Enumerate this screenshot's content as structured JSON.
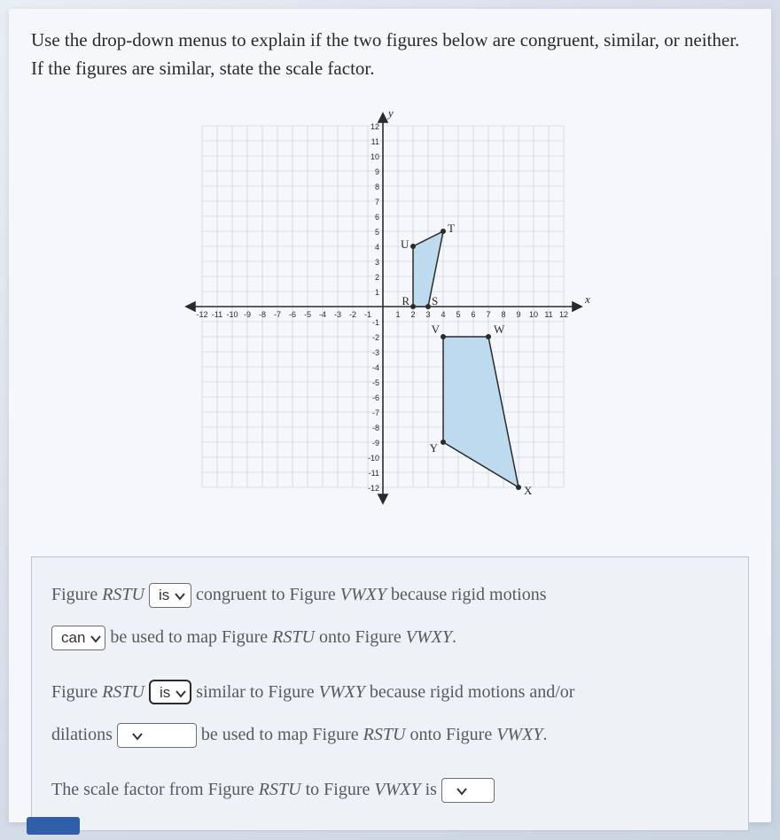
{
  "prompt": "Use the drop-down menus to explain if the two figures below are congruent, similar, or neither. If the figures are similar, state the scale factor.",
  "axis": {
    "xlabel": "x",
    "ylabel": "y",
    "x_ticks": [
      "-12",
      "-11",
      "-10",
      "-9",
      "-8",
      "-7",
      "-6",
      "-5",
      "-4",
      "-3",
      "-2",
      "-1",
      "1",
      "2",
      "3",
      "4",
      "5",
      "6",
      "7",
      "8",
      "9",
      "10",
      "11",
      "12"
    ],
    "y_ticks_pos": [
      "12",
      "11",
      "10",
      "9",
      "8",
      "7",
      "6",
      "5",
      "4",
      "3",
      "2",
      "1"
    ],
    "y_ticks_neg": [
      "-1",
      "-2",
      "-3",
      "-4",
      "-5",
      "-6",
      "-7",
      "-8",
      "-9",
      "-10",
      "-11",
      "-12"
    ]
  },
  "chart_data": {
    "type": "scatter",
    "title": "",
    "xlabel": "x",
    "ylabel": "y",
    "xlim": [
      -12,
      12
    ],
    "ylim": [
      -12,
      12
    ],
    "series": [
      {
        "name": "RSTU",
        "points": [
          {
            "label": "R",
            "x": 2,
            "y": 0
          },
          {
            "label": "S",
            "x": 3,
            "y": 0
          },
          {
            "label": "T",
            "x": 4,
            "y": 5
          },
          {
            "label": "U",
            "x": 2,
            "y": 4
          }
        ]
      },
      {
        "name": "VWXY",
        "points": [
          {
            "label": "V",
            "x": 4,
            "y": -2
          },
          {
            "label": "W",
            "x": 7,
            "y": -2
          },
          {
            "label": "X",
            "x": 9,
            "y": -12
          },
          {
            "label": "Y",
            "x": 4,
            "y": -9
          }
        ]
      }
    ]
  },
  "labels": {
    "R": "R",
    "S": "S",
    "T": "T",
    "U": "U",
    "V": "V",
    "W": "W",
    "X": "X",
    "Y": "Y"
  },
  "answer": {
    "line1_pre": "Figure ",
    "fig1": "RSTU",
    "dd1": "is",
    "line1_mid": " congruent to Figure ",
    "fig2": "VWXY",
    "line1_post": " because rigid motions",
    "dd2": "can",
    "line2_post": " be used to map Figure ",
    "line2_end": " onto Figure ",
    "period": ".",
    "line3_pre": "Figure ",
    "dd3": "is",
    "line3_mid": " similar to Figure ",
    "line3_post": " because rigid motions and/or",
    "line4_pre": "dilations ",
    "dd4": "",
    "line4_mid": " be used to map Figure ",
    "line4_end": " onto Figure ",
    "line5_pre": "The scale factor from Figure ",
    "line5_mid": " to Figure ",
    "line5_post": " is ",
    "dd5": ""
  }
}
